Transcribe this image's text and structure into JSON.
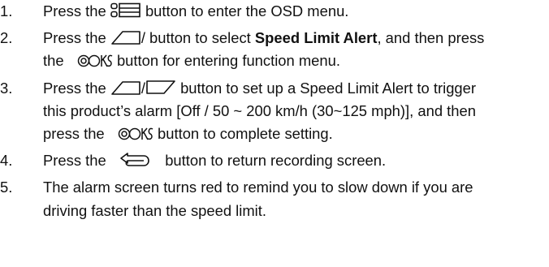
{
  "steps": [
    {
      "number": "1.",
      "before": "Press the",
      "icon": "menu-icon",
      "after": "button to enter the OSD menu."
    },
    {
      "number": "2.",
      "before": "Press the",
      "icon": "up-icon",
      "mid": "/ button to select",
      "bold": "Speed Limit Alert",
      "after": ", and then press",
      "line2_before": "the",
      "line2_icon": "ok-icon",
      "line2_after": "button for entering function menu."
    },
    {
      "number": "3.",
      "before": "Press the",
      "icon": "up-icon",
      "sep": "/",
      "icon2": "down-icon",
      "after": "button to set up a Speed Limit Alert to trigger",
      "line2": "this product’s alarm [Off / 50 ~ 200 km/h (30~125 mph)], and then",
      "line3_before": "press the",
      "line3_icon": "ok-icon",
      "line3_after": "button to complete setting."
    },
    {
      "number": "4.",
      "before": "Press the",
      "icon": "return-icon",
      "after": "button to return recording screen."
    },
    {
      "number": "5.",
      "line1": "The alarm screen turns red to remind you to slow down if you are",
      "line2": "driving faster than the speed limit."
    }
  ]
}
